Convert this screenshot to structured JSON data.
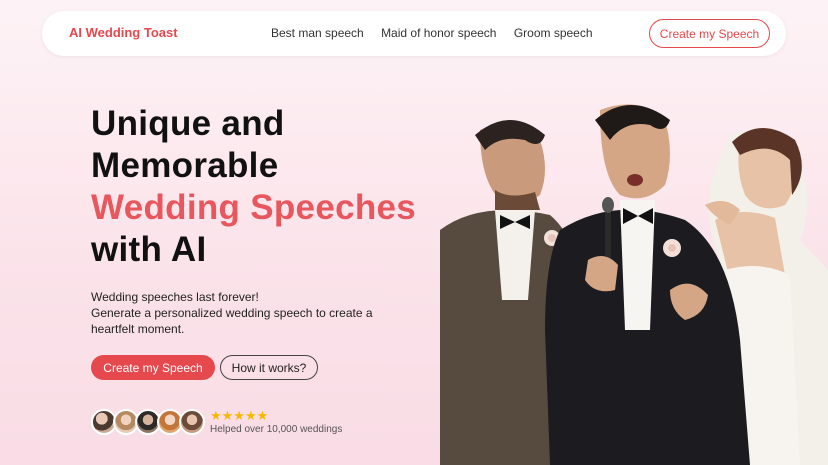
{
  "nav": {
    "brand": "AI Wedding Toast",
    "links": [
      "Best man speech",
      "Maid of honor speech",
      "Groom speech"
    ],
    "cta": "Create my Speech"
  },
  "hero": {
    "title_line1": "Unique and",
    "title_line2": "Memorable",
    "title_accent": "Wedding Speeches",
    "title_line4": "with AI",
    "subtitle_line1": "Wedding speeches last forever!",
    "subtitle_line2": "Generate a personalized wedding speech to create a heartfelt moment.",
    "primary_button": "Create my Speech",
    "secondary_button": "How it works?",
    "stars": "★★★★★",
    "social_proof": "Helped over 10,000 weddings"
  },
  "colors": {
    "accent": "#e5484d",
    "background": "#fbe3ea",
    "star": "#f6b800"
  },
  "icons": [
    "star-icon",
    "avatar-image"
  ]
}
